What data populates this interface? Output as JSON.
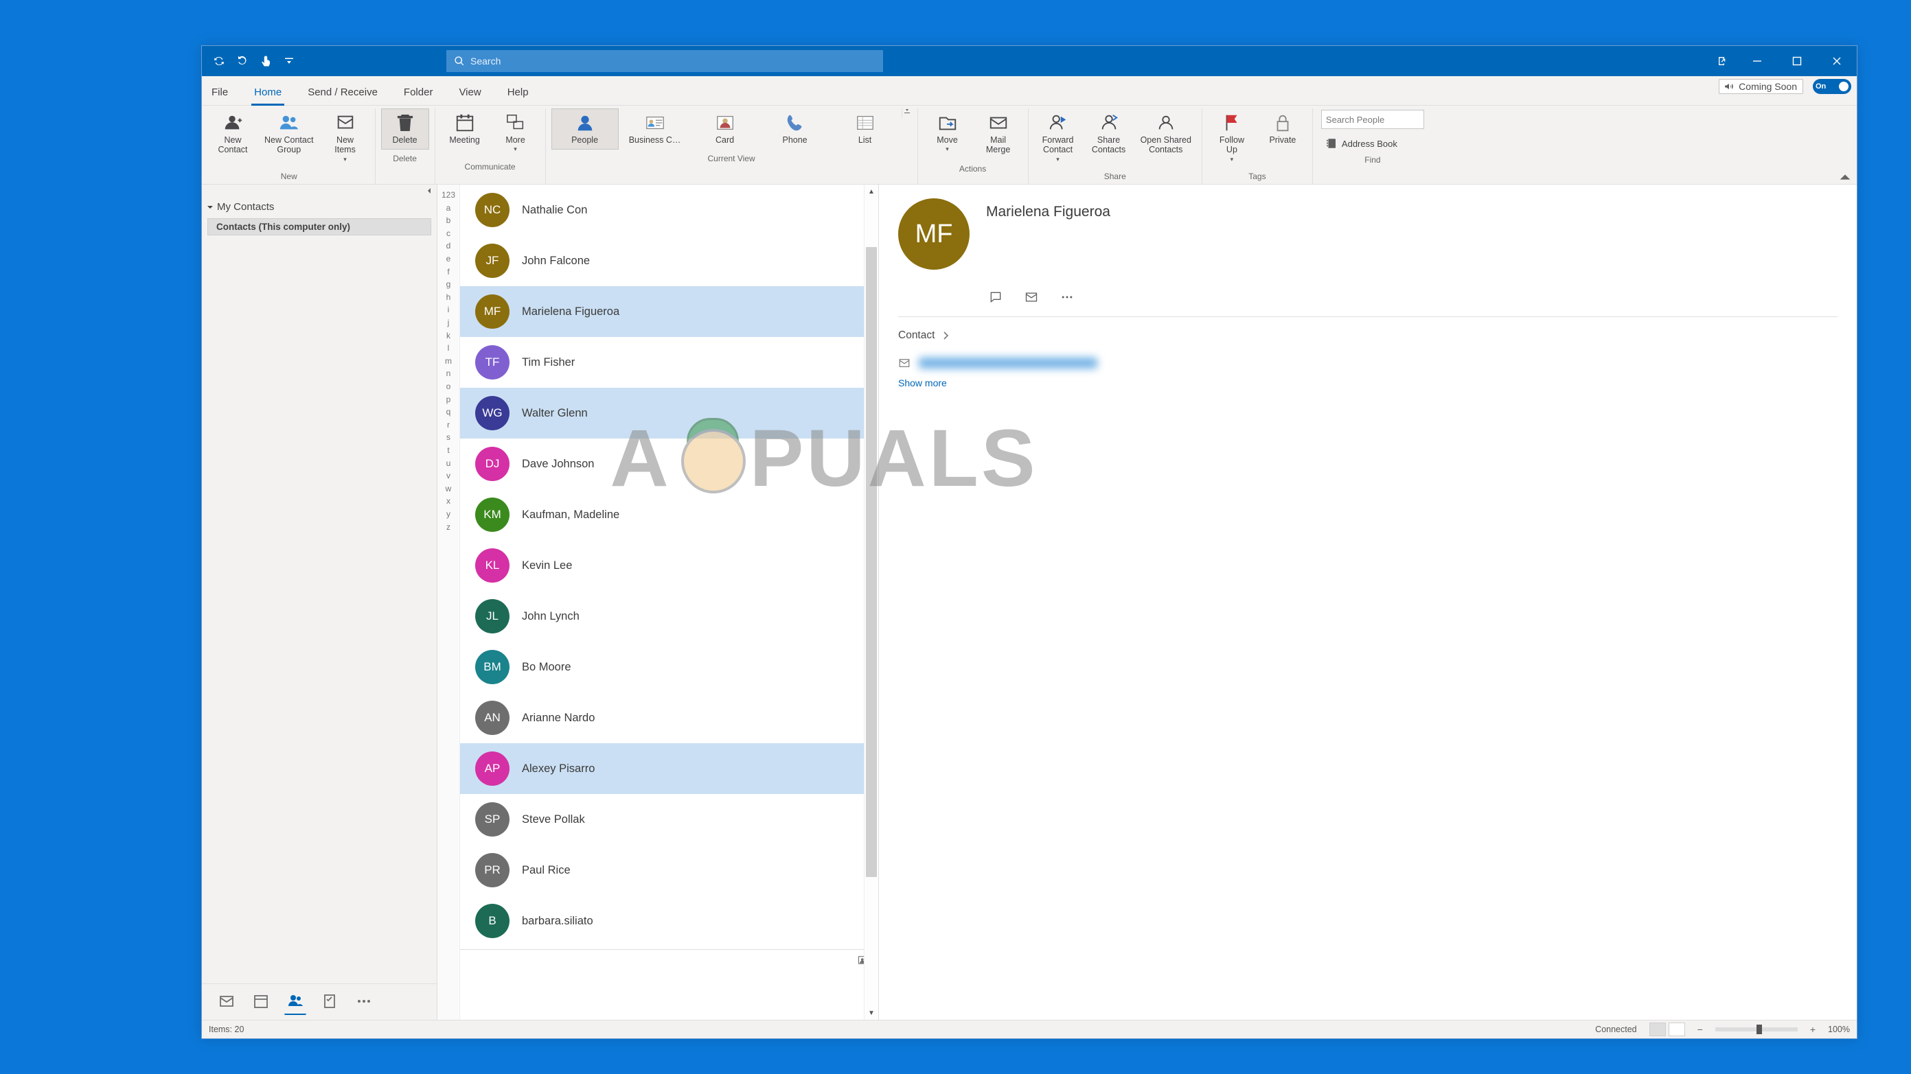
{
  "search": {
    "placeholder": "Search"
  },
  "tabs": {
    "file": "File",
    "home": "Home",
    "sendreceive": "Send / Receive",
    "folder": "Folder",
    "view": "View",
    "help": "Help"
  },
  "comingSoon": {
    "label": "Coming Soon",
    "toggleText": "On"
  },
  "ribbon": {
    "new": {
      "label": "New",
      "contact": "New\nContact",
      "group": "New Contact\nGroup",
      "items": "New\nItems"
    },
    "delete": {
      "label": "Delete",
      "btn": "Delete"
    },
    "communicate": {
      "label": "Communicate",
      "meeting": "Meeting",
      "more": "More"
    },
    "currentView": {
      "label": "Current View",
      "people": "People",
      "bcard": "Business C…",
      "card": "Card",
      "phone": "Phone",
      "list": "List"
    },
    "actions": {
      "label": "Actions",
      "move": "Move",
      "merge": "Mail\nMerge"
    },
    "share": {
      "label": "Share",
      "forward": "Forward\nContact",
      "sharec": "Share\nContacts",
      "open": "Open Shared\nContacts"
    },
    "tags": {
      "label": "Tags",
      "follow": "Follow\nUp",
      "private": "Private"
    },
    "find": {
      "label": "Find",
      "searchPeople": "Search People",
      "addressBook": "Address Book"
    }
  },
  "nav": {
    "myContacts": "My Contacts",
    "folder": "Contacts (This computer only)"
  },
  "alpha": [
    "123",
    "a",
    "b",
    "c",
    "d",
    "e",
    "f",
    "g",
    "h",
    "i",
    "j",
    "k",
    "l",
    "m",
    "n",
    "o",
    "p",
    "q",
    "r",
    "s",
    "t",
    "u",
    "v",
    "w",
    "x",
    "y",
    "z"
  ],
  "contacts": [
    {
      "initials": "NC",
      "name": "Nathalie Con",
      "color": "#8b6e0d",
      "selected": false
    },
    {
      "initials": "JF",
      "name": "John Falcone",
      "color": "#8b6e0d",
      "selected": false
    },
    {
      "initials": "MF",
      "name": "Marielena Figueroa",
      "color": "#8b6e0d",
      "selected": true
    },
    {
      "initials": "TF",
      "name": "Tim Fisher",
      "color": "#8060d1",
      "selected": false
    },
    {
      "initials": "WG",
      "name": "Walter Glenn",
      "color": "#3a3a97",
      "selected": true
    },
    {
      "initials": "DJ",
      "name": "Dave Johnson",
      "color": "#d530a5",
      "selected": false
    },
    {
      "initials": "KM",
      "name": "Kaufman, Madeline",
      "color": "#3b8a1d",
      "selected": false
    },
    {
      "initials": "KL",
      "name": "Kevin Lee",
      "color": "#d530a5",
      "selected": false
    },
    {
      "initials": "JL",
      "name": "John Lynch",
      "color": "#1d6b55",
      "selected": false
    },
    {
      "initials": "BM",
      "name": "Bo Moore",
      "color": "#1a838c",
      "selected": false
    },
    {
      "initials": "AN",
      "name": "Arianne Nardo",
      "color": "#6e6e6e",
      "selected": false
    },
    {
      "initials": "AP",
      "name": "Alexey Pisarro",
      "color": "#d530a5",
      "selected": true
    },
    {
      "initials": "SP",
      "name": "Steve Pollak",
      "color": "#6e6e6e",
      "selected": false
    },
    {
      "initials": "PR",
      "name": "Paul Rice",
      "color": "#6e6e6e",
      "selected": false
    },
    {
      "initials": "B",
      "name": "barbara.siliato",
      "color": "#1d6b55",
      "selected": false
    }
  ],
  "detail": {
    "initials": "MF",
    "name": "Marielena Figueroa",
    "sectionLabel": "Contact",
    "showMore": "Show more"
  },
  "status": {
    "items": "Items: 20",
    "connected": "Connected",
    "zoom": "100%"
  },
  "watermark": {
    "leading": "A",
    "trailing": "PUALS"
  }
}
